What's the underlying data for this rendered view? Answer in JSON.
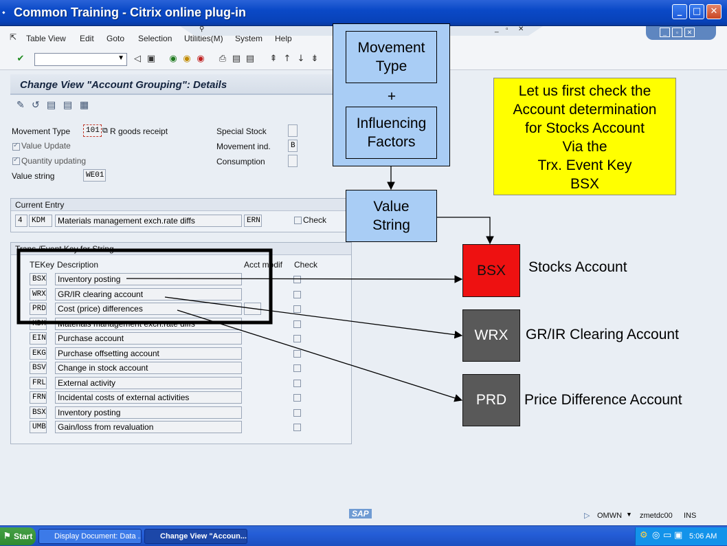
{
  "window": {
    "title": "Common Training - Citrix online plug-in"
  },
  "menu": {
    "items": [
      "Table View",
      "Edit",
      "Goto",
      "Selection",
      "Utilities(M)",
      "System",
      "Help"
    ]
  },
  "screen": {
    "title": "Change View \"Account Grouping\": Details"
  },
  "header_fields": {
    "movement_type_label": "Movement Type",
    "movement_type_value": "101",
    "movement_type_text": "R goods receipt",
    "value_update_label": "Value Update",
    "quantity_updating_label": "Quantity updating",
    "value_string_label": "Value string",
    "value_string_value": "WE01",
    "special_stock_label": "Special Stock",
    "special_stock_value": "",
    "movement_ind_label": "Movement ind.",
    "movement_ind_value": "B",
    "consumption_label": "Consumption",
    "consumption_value": ""
  },
  "current_entry": {
    "header": "Current Entry",
    "num": "4",
    "key": "KDM",
    "description": "Materials management exch.rate diffs",
    "acct_modif": "ERN",
    "check_label": "Check"
  },
  "te_keys": {
    "header": "Trans./Event Key for String",
    "col_tekey": "TEKey",
    "col_description": "Description",
    "col_acct_modif": "Acct modif",
    "col_check": "Check",
    "rows": [
      {
        "key": "BSX",
        "desc": "Inventory posting",
        "modif": ""
      },
      {
        "key": "WRX",
        "desc": "GR/IR clearing account",
        "modif": ""
      },
      {
        "key": "PRD",
        "desc": "Cost (price) differences",
        "modif": ""
      },
      {
        "key": "KDM",
        "desc": "Materials management exch.rate diffs",
        "modif": ""
      },
      {
        "key": "EIN",
        "desc": "Purchase account",
        "modif": ""
      },
      {
        "key": "EKG",
        "desc": "Purchase offsetting account",
        "modif": ""
      },
      {
        "key": "BSV",
        "desc": "Change in stock account",
        "modif": ""
      },
      {
        "key": "FRL",
        "desc": "External activity",
        "modif": ""
      },
      {
        "key": "FRN",
        "desc": "Incidental costs of external activities",
        "modif": ""
      },
      {
        "key": "BSX",
        "desc": "Inventory posting",
        "modif": ""
      },
      {
        "key": "UMB",
        "desc": "Gain/loss from revaluation",
        "modif": ""
      }
    ]
  },
  "diagram": {
    "movement_type_line1": "Movement",
    "movement_type_line2": "Type",
    "plus": "+",
    "influencing_line1": "Influencing",
    "influencing_line2": "Factors",
    "value_string_line1": "Value",
    "value_string_line2": "String",
    "note_lines": [
      "Let us first check the",
      "Account determination",
      "for Stocks Account",
      "Via the",
      "Trx. Event Key",
      "BSX"
    ],
    "bsx_box": "BSX",
    "bsx_label": "Stocks Account",
    "wrx_box": "WRX",
    "wrx_label": "GR/IR Clearing Account",
    "prd_box": "PRD",
    "prd_label": "Price Difference Account",
    "colors": {
      "bsx": "#ee1111",
      "wrx": "#595959",
      "prd": "#595959",
      "note": "#ffff00",
      "blue": "#a9cdf5"
    }
  },
  "status": {
    "sap_logo": "SAP",
    "system": "OMWN",
    "server": "zmetdc00",
    "mode": "INS"
  },
  "taskbar": {
    "start": "Start",
    "task1": "Display Document: Data ...",
    "task2": "Change View \"Accoun...",
    "clock": "5:06 AM"
  }
}
